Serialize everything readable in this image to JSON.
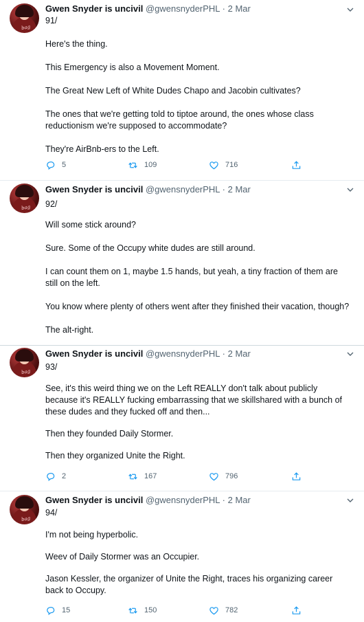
{
  "author": {
    "display_name": "Gwen Snyder is uncivil",
    "handle_date": "@gwensnyderPHL · 2 Mar"
  },
  "tweets": [
    {
      "number": "91/",
      "paragraphs": [
        "Here's the thing.",
        "This Emergency is also a Movement Moment.",
        "The Great New Left of White Dudes Chapo and Jacobin cultivates?",
        "The ones that we're getting told to tiptoe around, the ones whose class reductionism we're supposed to accommodate?",
        "They're AirBnb-ers to the Left."
      ],
      "replies": "5",
      "retweets": "109",
      "likes": "716"
    },
    {
      "number": "92/",
      "paragraphs": [
        "Will some stick around?",
        "Sure. Some of the Occupy white dudes are still around.",
        "I can count them on 1, maybe 1.5 hands, but yeah, a tiny fraction of them are still on the left.",
        "You know where plenty of others went after they finished their vacation, though?",
        "The alt-right."
      ]
    },
    {
      "number": "93/",
      "paragraphs": [
        "See, it's this weird thing we on the Left REALLY don't talk about publicly because it's REALLY fucking embarrassing that we skillshared with a bunch of these dudes and they fucked off and then...",
        "Then they founded Daily Stormer.",
        "Then they organized Unite the Right."
      ],
      "replies": "2",
      "retweets": "167",
      "likes": "796"
    },
    {
      "number": "94/",
      "paragraphs": [
        "I'm not being hyperbolic.",
        "Weev of Daily Stormer was an Occupier.",
        "Jason Kessler, the organizer of Unite the Right, traces his organizing career back to Occupy."
      ],
      "replies": "15",
      "retweets": "150",
      "likes": "782"
    }
  ],
  "icons": {
    "reply": "reply-icon",
    "retweet": "retweet-icon",
    "like": "heart-icon",
    "share": "share-icon",
    "more": "chevron-down-icon"
  },
  "colors": {
    "text": "#0f1419",
    "secondary": "#536471",
    "icon": "#1d9bf0",
    "divider": "#e6ecf0"
  }
}
